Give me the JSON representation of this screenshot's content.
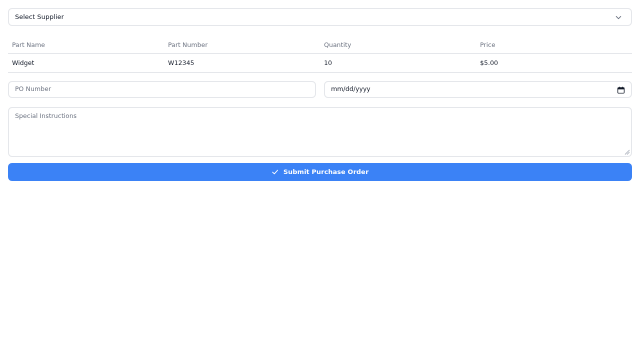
{
  "supplier_select": {
    "value": "Select Supplier"
  },
  "parts_table": {
    "headers": [
      "Part Name",
      "Part Number",
      "Quantity",
      "Price"
    ],
    "rows": [
      [
        "Widget",
        "W12345",
        "10",
        "$5.00"
      ]
    ]
  },
  "po_number": {
    "placeholder": "PO Number"
  },
  "delivery_date": {
    "placeholder": "mm/dd/yyyy"
  },
  "special_instructions": {
    "placeholder": "Special Instructions"
  },
  "submit": {
    "label": "Submit Purchase Order",
    "icon": "check-icon"
  },
  "colors": {
    "accent": "#3b82f6",
    "border": "#e5e7eb",
    "muted_text": "#6b7280"
  }
}
